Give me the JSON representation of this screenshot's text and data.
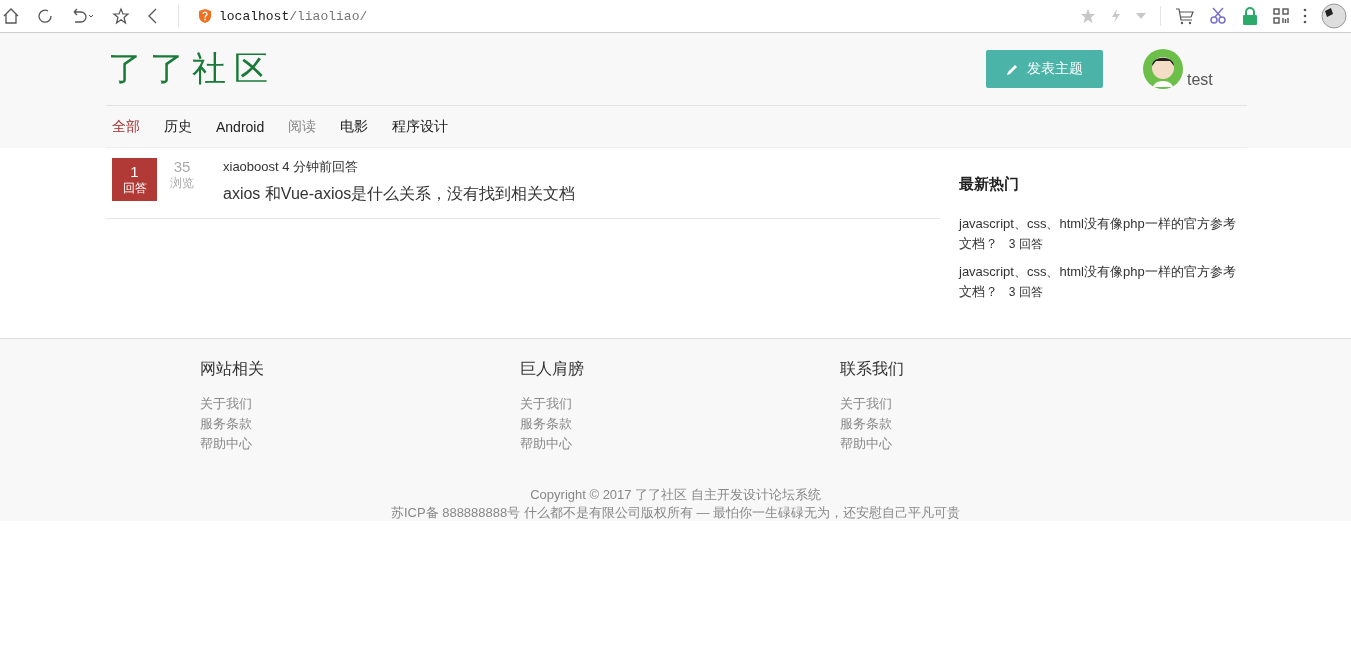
{
  "browser": {
    "url_host": "localhost",
    "url_path": "/liaoliao/"
  },
  "header": {
    "logo": "了了社区",
    "post_button": "发表主题",
    "user": "test"
  },
  "tabs": [
    {
      "label": "全部",
      "selected": true,
      "disabled": false
    },
    {
      "label": "历史",
      "selected": false,
      "disabled": false
    },
    {
      "label": "Android",
      "selected": false,
      "disabled": false
    },
    {
      "label": "阅读",
      "selected": false,
      "disabled": true
    },
    {
      "label": "电影",
      "selected": false,
      "disabled": false
    },
    {
      "label": "程序设计",
      "selected": false,
      "disabled": false
    }
  ],
  "questions": [
    {
      "answers": "1",
      "answers_label": "回答",
      "views": "35",
      "views_label": "浏览",
      "meta": "xiaoboost 4 分钟前回答",
      "title": "axios 和Vue-axios是什么关系，没有找到相关文档"
    }
  ],
  "sidebar": {
    "title": "最新热门",
    "items": [
      {
        "title": "javascript、css、html没有像php一样的官方参考文档？",
        "count": "3 回答"
      },
      {
        "title": "javascript、css、html没有像php一样的官方参考文档？",
        "count": "3 回答"
      }
    ]
  },
  "footer": {
    "columns": [
      {
        "title": "网站相关",
        "links": [
          "关于我们",
          "服务条款",
          "帮助中心"
        ]
      },
      {
        "title": "巨人肩膀",
        "links": [
          "关于我们",
          "服务条款",
          "帮助中心"
        ]
      },
      {
        "title": "联系我们",
        "links": [
          "关于我们",
          "服务条款",
          "帮助中心"
        ]
      }
    ],
    "copyright": "Copyright © 2017 了了社区 自主开发设计论坛系统",
    "icp": "苏ICP备 888888888号 什么都不是有限公司版权所有 — 最怕你一生碌碌无为，还安慰自己平凡可贵"
  }
}
